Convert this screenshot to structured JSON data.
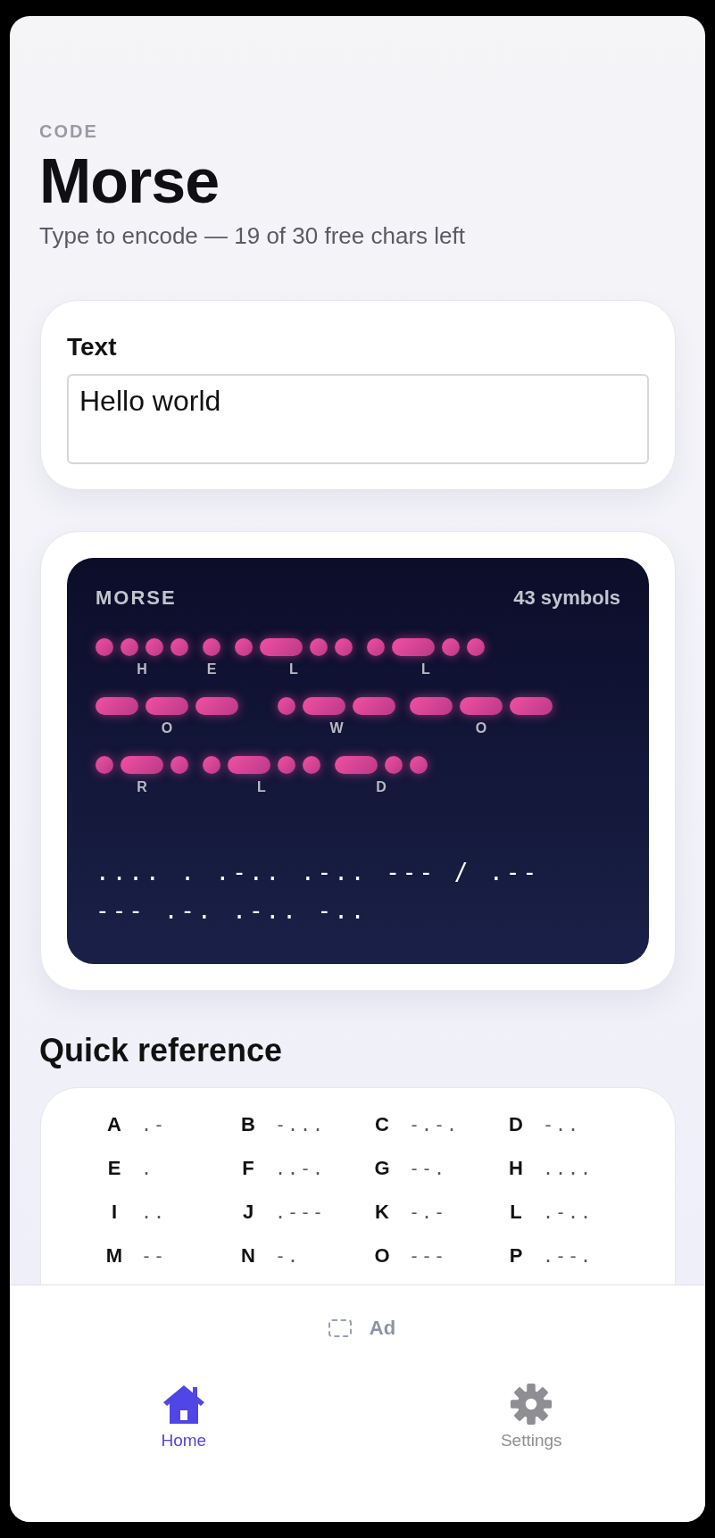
{
  "header": {
    "eyebrow": "CODE",
    "title": "Morse",
    "subtitle": "Type to encode — 19 of 30 free chars left"
  },
  "text_card": {
    "label": "Text",
    "value": "Hello world"
  },
  "morse_card": {
    "label": "MORSE",
    "count": "43 symbols",
    "words": [
      {
        "letters": [
          {
            "char": "H",
            "symbols": [
              {
                "kind": "dot"
              },
              {
                "kind": "dot"
              },
              {
                "kind": "dot"
              },
              {
                "kind": "dot"
              }
            ]
          },
          {
            "char": "E",
            "symbols": [
              {
                "kind": "dot"
              }
            ]
          },
          {
            "char": "L",
            "symbols": [
              {
                "kind": "dot"
              },
              {
                "kind": "dash"
              },
              {
                "kind": "dot"
              },
              {
                "kind": "dot"
              }
            ]
          },
          {
            "char": "L",
            "symbols": [
              {
                "kind": "dot"
              },
              {
                "kind": "dash"
              },
              {
                "kind": "dot"
              },
              {
                "kind": "dot"
              }
            ]
          },
          {
            "char": "O",
            "symbols": [
              {
                "kind": "dash"
              },
              {
                "kind": "dash"
              },
              {
                "kind": "dash"
              }
            ]
          }
        ]
      },
      {
        "letters": [
          {
            "char": "W",
            "symbols": [
              {
                "kind": "dot"
              },
              {
                "kind": "dash"
              },
              {
                "kind": "dash"
              }
            ]
          },
          {
            "char": "O",
            "symbols": [
              {
                "kind": "dash"
              },
              {
                "kind": "dash"
              },
              {
                "kind": "dash"
              }
            ]
          },
          {
            "char": "R",
            "symbols": [
              {
                "kind": "dot"
              },
              {
                "kind": "dash"
              },
              {
                "kind": "dot"
              }
            ]
          },
          {
            "char": "L",
            "symbols": [
              {
                "kind": "dot"
              },
              {
                "kind": "dash"
              },
              {
                "kind": "dot"
              },
              {
                "kind": "dot"
              }
            ]
          },
          {
            "char": "D",
            "symbols": [
              {
                "kind": "dash"
              },
              {
                "kind": "dot"
              },
              {
                "kind": "dot"
              }
            ]
          }
        ]
      }
    ],
    "text": ".... . .-.. .-.. --- / .-- --- .-. .-.. -.."
  },
  "quick_reference": {
    "title": "Quick reference",
    "items": [
      {
        "letter": "A",
        "code": ".-"
      },
      {
        "letter": "B",
        "code": "-..."
      },
      {
        "letter": "C",
        "code": "-.-."
      },
      {
        "letter": "D",
        "code": "-.."
      },
      {
        "letter": "E",
        "code": "."
      },
      {
        "letter": "F",
        "code": "..-."
      },
      {
        "letter": "G",
        "code": "--."
      },
      {
        "letter": "H",
        "code": "...."
      },
      {
        "letter": "I",
        "code": ".."
      },
      {
        "letter": "J",
        "code": ".---"
      },
      {
        "letter": "K",
        "code": "-.-"
      },
      {
        "letter": "L",
        "code": ".-.."
      },
      {
        "letter": "M",
        "code": "--"
      },
      {
        "letter": "N",
        "code": "-."
      },
      {
        "letter": "O",
        "code": "---"
      },
      {
        "letter": "P",
        "code": ".--."
      }
    ]
  },
  "ad": {
    "label": "Ad"
  },
  "tabs": [
    {
      "label": "Home",
      "kind": "home",
      "selected": true
    },
    {
      "label": "Settings",
      "kind": "settings",
      "selected": false
    }
  ]
}
